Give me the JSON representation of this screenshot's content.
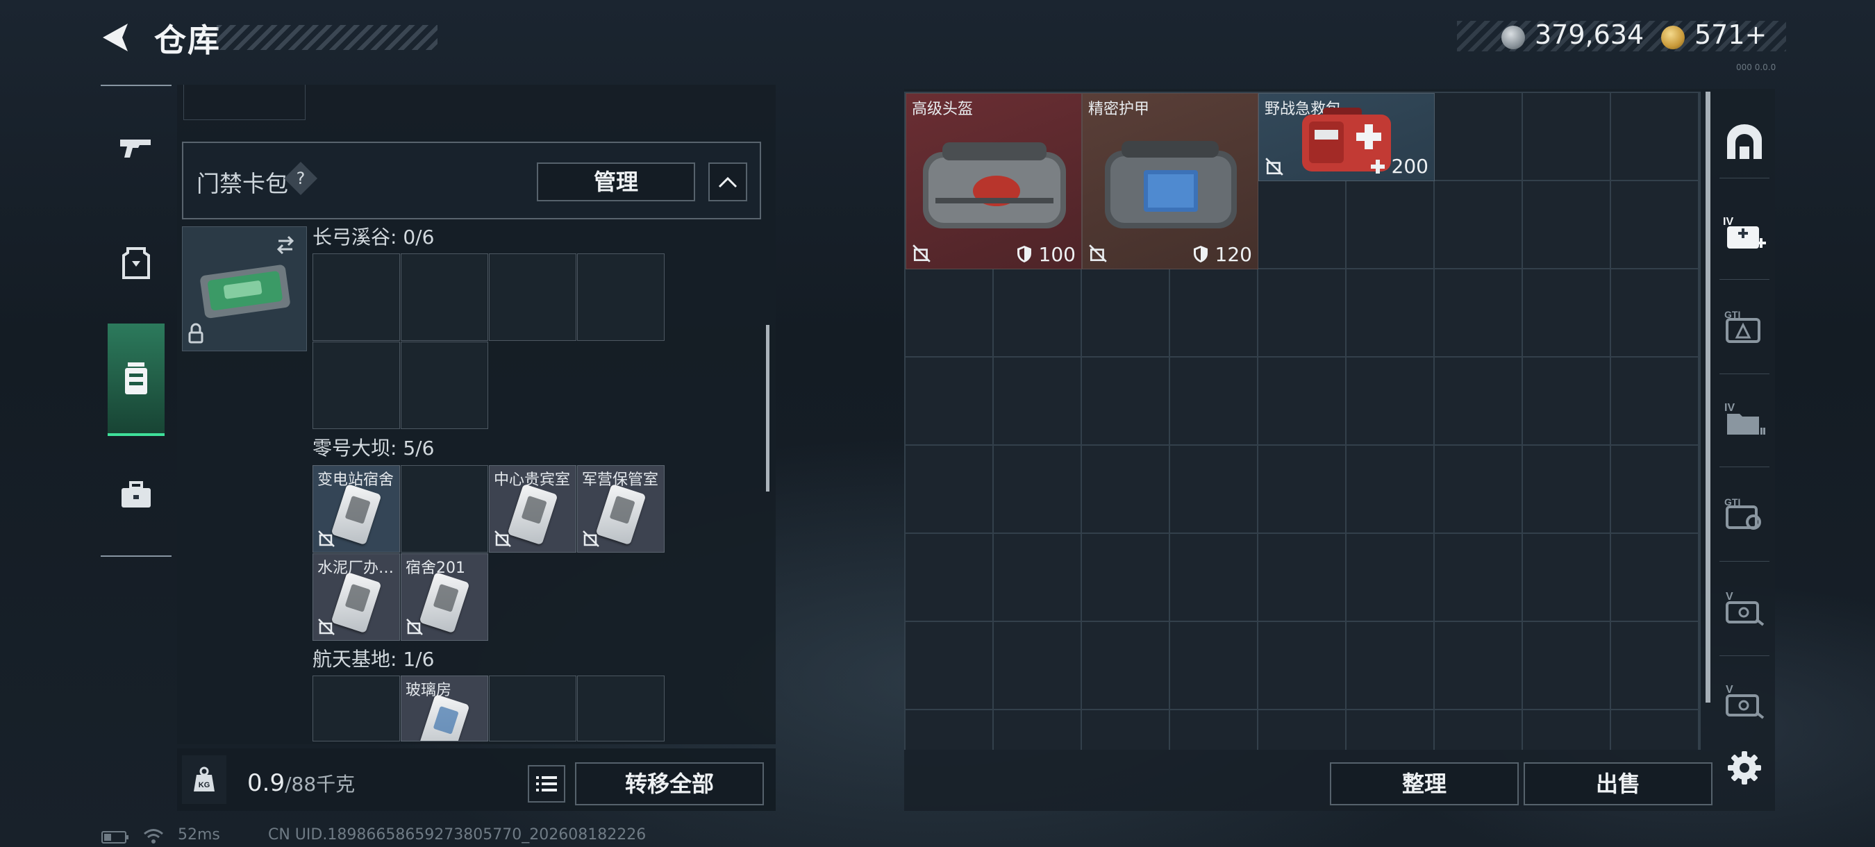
{
  "header": {
    "title": "仓库"
  },
  "currency": {
    "silver": "379,634",
    "gold": "571+"
  },
  "tiny_text": "000 0.0.0",
  "left_nav": [
    {
      "name": "weapon-tab",
      "icon": "gun-icon"
    },
    {
      "name": "equipment-tab",
      "icon": "vest-icon"
    },
    {
      "name": "container-tab",
      "icon": "backpack-icon",
      "active": true
    },
    {
      "name": "case-tab",
      "icon": "briefcase-icon"
    }
  ],
  "keycard_pack": {
    "title": "门禁卡包",
    "help": "?",
    "manage_label": "管理"
  },
  "sections": [
    {
      "label": "长弓溪谷: 0/6"
    },
    {
      "label": "零号大坝: 5/6",
      "keys": [
        "变电站宿舍",
        "中心贵宾室",
        "军营保管室",
        "水泥厂办…",
        "宿舍201"
      ]
    },
    {
      "label": "航天基地: 1/6",
      "keys": [
        "玻璃房"
      ]
    }
  ],
  "footer": {
    "weight": "0.9",
    "weight_max": "/88千克",
    "transfer_all": "转移全部"
  },
  "status_bar": {
    "ping": "52ms",
    "uid": "CN UID.18986658659273805770_202608182226"
  },
  "items": [
    {
      "label": "高级头盔",
      "value": "100",
      "value_icon": "shield-icon"
    },
    {
      "label": "精密护甲",
      "value": "120",
      "value_icon": "shield-icon"
    },
    {
      "label": "野战急救包",
      "value": "200",
      "value_icon": "plus-icon"
    }
  ],
  "right_sidebar": [
    "vault-icon",
    "iv-plus-icon",
    "gti-a-icon",
    "iv-folder-icon",
    "gti-c-icon",
    "v-case-icon",
    "v-case2-icon"
  ],
  "actions": {
    "sort": "整理",
    "sell": "出售"
  },
  "colors": {
    "accent": "#3fe09a",
    "helmet_bg": "#5a2a2e",
    "armor_bg": "#4c3630",
    "medkit_bg": "#2e4150"
  }
}
